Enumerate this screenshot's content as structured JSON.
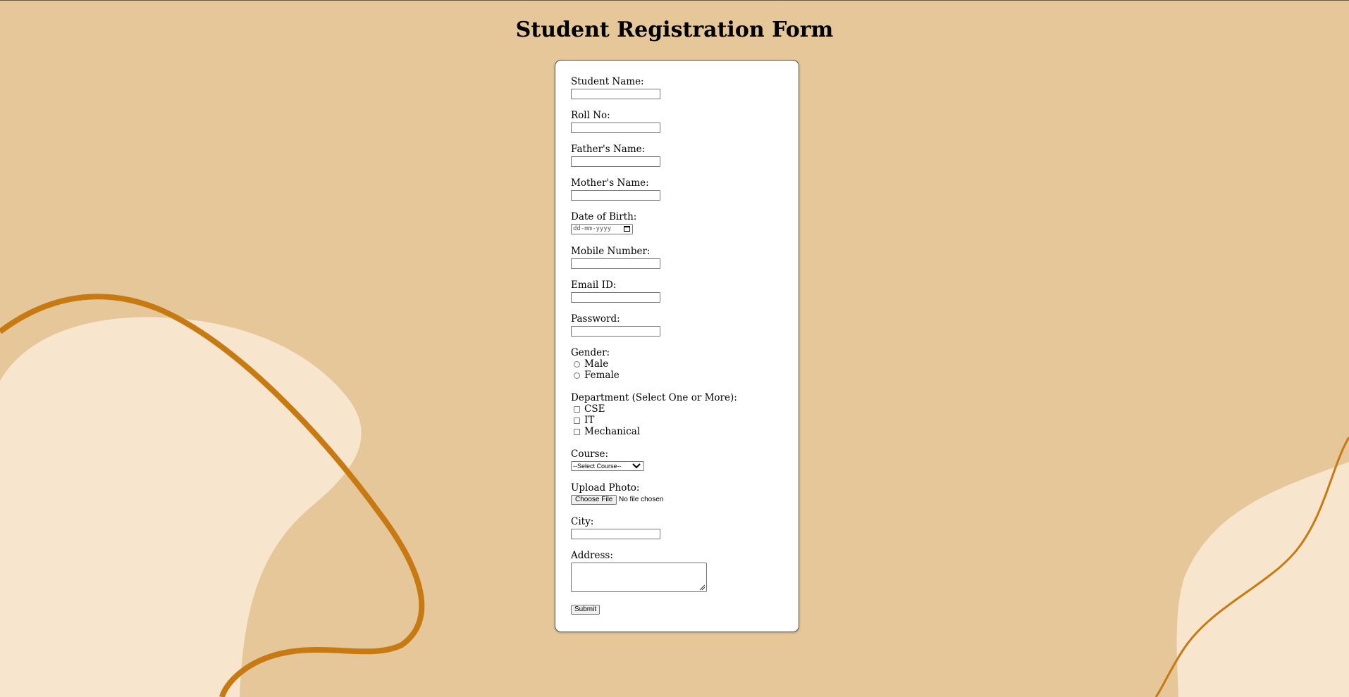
{
  "page": {
    "title": "Student Registration Form",
    "colors": {
      "background": "#e6c79a",
      "blob": "#f8e5cd",
      "curve": "#c77a12",
      "card": "#ffffff"
    }
  },
  "form": {
    "student_name": {
      "label": "Student Name:",
      "value": ""
    },
    "roll_no": {
      "label": "Roll No:",
      "value": ""
    },
    "father_name": {
      "label": "Father's Name:",
      "value": ""
    },
    "mother_name": {
      "label": "Mother's Name:",
      "value": ""
    },
    "dob": {
      "label": "Date of Birth:",
      "placeholder": "dd-mm-yyyy",
      "icon": "calendar-icon"
    },
    "mobile": {
      "label": "Mobile Number:",
      "value": ""
    },
    "email": {
      "label": "Email ID:",
      "value": ""
    },
    "password": {
      "label": "Password:",
      "value": ""
    },
    "gender": {
      "label": "Gender:",
      "options": [
        "Male",
        "Female"
      ]
    },
    "department": {
      "label": "Department (Select One or More):",
      "options": [
        "CSE",
        "IT",
        "Mechanical"
      ]
    },
    "course": {
      "label": "Course:",
      "selected": "--Select Course--",
      "icon": "chevron-down-icon"
    },
    "photo": {
      "label": "Upload Photo:",
      "button": "Choose File",
      "status": "No file chosen"
    },
    "city": {
      "label": "City:",
      "value": ""
    },
    "address": {
      "label": "Address:",
      "value": ""
    },
    "submit_label": "Submit"
  }
}
